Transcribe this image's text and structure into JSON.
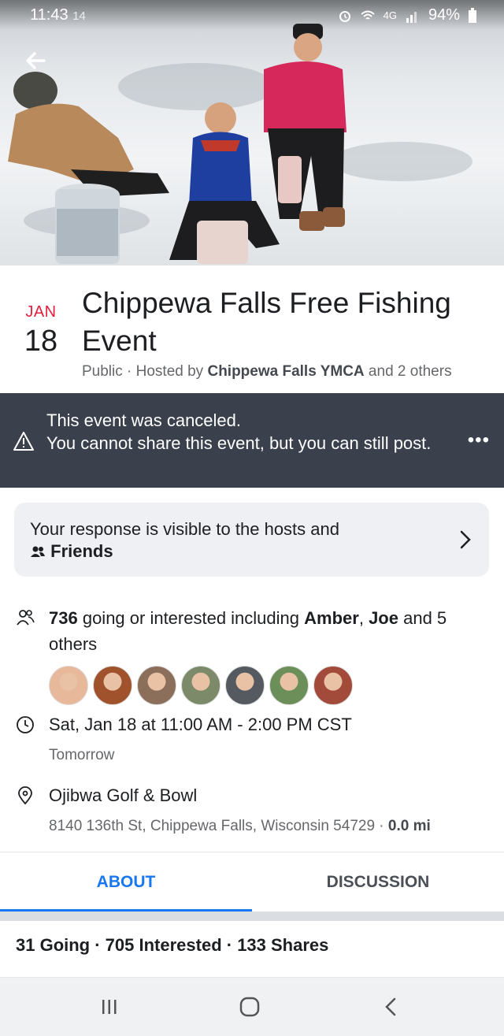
{
  "status_bar": {
    "time": "11:43",
    "extra": "14",
    "network": "4G",
    "battery": "94%"
  },
  "event": {
    "month": "JAN",
    "day": "18",
    "title": "Chippewa Falls Free Fishing Event",
    "host_prefix": "Public · Hosted by ",
    "host_name": "Chippewa Falls YMCA",
    "host_suffix": " and 2 others"
  },
  "banner": {
    "line1": "This event was canceled.",
    "line2": "You cannot share this event, but you can still post.",
    "more": "•••"
  },
  "response": {
    "line1": "Your response is visible to the hosts and",
    "line2": "Friends"
  },
  "attendance": {
    "count": "736",
    "text_a": " going or interested including ",
    "name1": "Amber",
    "sep": ", ",
    "name2": "Joe",
    "text_b": " and 5 others"
  },
  "avatars": [
    "#e8b89a",
    "#a0522d",
    "#8b6f5a",
    "#7d8a6a",
    "#555a60",
    "#6c8f5a",
    "#a34b3a"
  ],
  "datetime": {
    "main": "Sat, Jan 18 at 11:00 AM - 2:00 PM CST",
    "sub": "Tomorrow"
  },
  "location": {
    "name": "Ojibwa Golf & Bowl",
    "address": "8140 136th St, Chippewa Falls, Wisconsin 54729 · ",
    "distance": "0.0 mi"
  },
  "tabs": {
    "about": "ABOUT",
    "discussion": "DISCUSSION"
  },
  "stats": "31 Going · 705 Interested · 133 Shares",
  "colors": {
    "accent": "#1877f2",
    "month": "#e41e3f",
    "banner": "#3a414d"
  }
}
